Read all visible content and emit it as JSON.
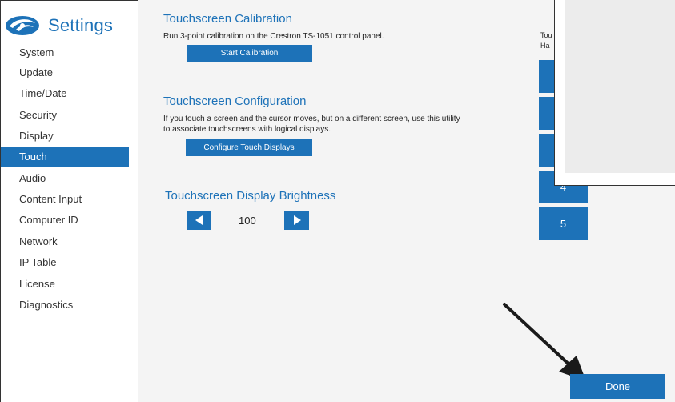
{
  "app": {
    "title": "Settings"
  },
  "sidebar": {
    "items": [
      {
        "label": "System"
      },
      {
        "label": "Update"
      },
      {
        "label": "Time/Date"
      },
      {
        "label": "Security"
      },
      {
        "label": "Display"
      },
      {
        "label": "Touch",
        "active": true
      },
      {
        "label": "Audio"
      },
      {
        "label": "Content Input"
      },
      {
        "label": "Computer ID"
      },
      {
        "label": "Network"
      },
      {
        "label": "IP Table"
      },
      {
        "label": "License"
      },
      {
        "label": "Diagnostics"
      }
    ]
  },
  "calibration": {
    "title": "Touchscreen Calibration",
    "description": "Run 3-point calibration on the Crestron TS-1051 control panel.",
    "button_label": "Start Calibration"
  },
  "configuration": {
    "title": "Touchscreen Configuration",
    "description": "If you touch a screen and the cursor moves, but on a different screen, use this utility to associate touchscreens with logical displays.",
    "button_label": "Configure Touch Displays"
  },
  "brightness": {
    "title": "Touchscreen Display Brightness",
    "value": "100"
  },
  "right_panel": {
    "text_line1": "Tou",
    "text_line2": "Ha",
    "buttons": [
      "",
      "",
      "",
      "4",
      "5"
    ]
  },
  "done_label": "Done",
  "colors": {
    "accent": "#1d72b8",
    "main_bg": "#f4f4f4"
  },
  "icons": [
    "crestron-logo-icon",
    "arrow-left-icon",
    "arrow-right-icon",
    "pointer-arrow-icon"
  ]
}
